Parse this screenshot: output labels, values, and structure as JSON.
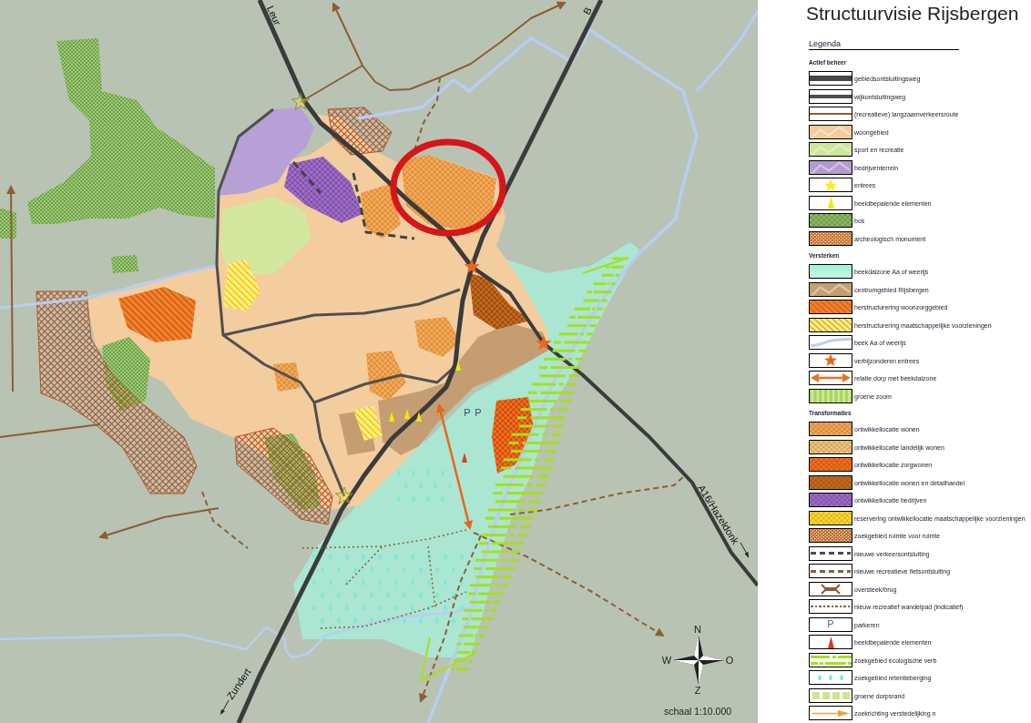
{
  "map": {
    "road_labels": [
      "Leur",
      "B",
      "A16/Hazeldonk",
      "Zundert"
    ],
    "parking_labels": [
      "P",
      "P"
    ],
    "compass": {
      "north": "N",
      "west": "W",
      "east": "O",
      "south": "Z"
    },
    "scale": "schaal 1:10.000"
  },
  "legend_panel": {
    "title": "Structuurvisie Rijsbergen",
    "heading": "Legenda",
    "sections": [
      {
        "title": "Actief beheer",
        "items": [
          {
            "label": "gebiedsontsluitingsweg",
            "kind": "line-thick",
            "color": "#464646"
          },
          {
            "label": "wijkontsluitingweg",
            "kind": "line-medium",
            "color": "#4d4d4d"
          },
          {
            "label": "(recreatieve) langzaamverkeersroute",
            "kind": "line-thin",
            "color": "#8c5e34"
          },
          {
            "label": "woongebied",
            "kind": "area",
            "color": "#f3cc9e"
          },
          {
            "label": "sport en recreatie",
            "kind": "area",
            "color": "#cfe79a"
          },
          {
            "label": "bedrijventerrein",
            "kind": "area",
            "color": "#b39bd0"
          },
          {
            "label": "entrees",
            "kind": "star",
            "color": "#f4ee1e"
          },
          {
            "label": "beeldbepalende elementen",
            "kind": "cone",
            "color": "#f2ea00"
          },
          {
            "label": "bos",
            "kind": "checker",
            "color": "#8fbd62"
          },
          {
            "label": "archeologisch monument",
            "kind": "crosshatch",
            "color": "#c8702a"
          }
        ]
      },
      {
        "title": "Versterken",
        "items": [
          {
            "label": "beekdalzone Aa of weerijs",
            "kind": "gradient",
            "color": "#a9f1da"
          },
          {
            "label": "centrumgebied Rijsbergen",
            "kind": "area",
            "color": "#c4a071"
          },
          {
            "label": "herstructurering woonzorggebied",
            "kind": "hatch",
            "color": "#f57e2a"
          },
          {
            "label": "herstructurering maatschappelijke voorzieningen",
            "kind": "hatch",
            "color": "#fff07a"
          },
          {
            "label": "beek Aa of weerijs",
            "kind": "stream",
            "color": "#b9d0f5"
          },
          {
            "label": "verbijzonderen entrees",
            "kind": "star",
            "color": "#e8661e"
          },
          {
            "label": "relatie dorp met beekdalzone",
            "kind": "double-arrow",
            "color": "#e8751e"
          },
          {
            "label": "groene zoom",
            "kind": "stripes",
            "color": "#a8d65a"
          }
        ]
      },
      {
        "title": "Transformaties",
        "items": [
          {
            "label": "ontwikkellocatie wonen",
            "kind": "lattice",
            "color": "#f2a653"
          },
          {
            "label": "ontwikkellocatie landelijk wonen",
            "kind": "lattice",
            "color": "#f0c27a"
          },
          {
            "label": "ontwikkellocatie zorgwonen",
            "kind": "lattice",
            "color": "#f26b1d"
          },
          {
            "label": "ontwikkellocatie wonen en detailhandel",
            "kind": "lattice",
            "color": "#c1681d"
          },
          {
            "label": "ontwikkellocatie bedrijven",
            "kind": "lattice",
            "color": "#9e66c6"
          },
          {
            "label": "reservering ontwikkellocatie maatschappelijke voorzieningen",
            "kind": "lattice",
            "color": "#ffd52a"
          },
          {
            "label": "zoekgebied ruimte voor ruimte",
            "kind": "crosshatch",
            "color": "#c06a2a"
          },
          {
            "label": "nieuwe verkeersontsluiting",
            "kind": "dashed",
            "color": "#4d4d4d"
          },
          {
            "label": "nieuwe recreatieve fietsontsluiting",
            "kind": "dashed",
            "color": "#8c5e34"
          },
          {
            "label": "oversteek/brug",
            "kind": "bridge",
            "color": "#8c5e34"
          },
          {
            "label": "nieuw recreatief wandelpad (indicatief)",
            "kind": "dotted",
            "color": "#8c5e34"
          },
          {
            "label": "parkeren",
            "kind": "letter",
            "symbol": "P"
          },
          {
            "label": "beeldbepalende elementen",
            "kind": "cone",
            "color": "#d8401a"
          },
          {
            "label": "zoekgebied ecologische verb",
            "kind": "eco-dashes",
            "color": "#a6e01a"
          },
          {
            "label": "zoekgebied retentieberging",
            "kind": "drops",
            "color": "#7fe8d8"
          },
          {
            "label": "groene dorpsrand",
            "kind": "squares",
            "color": "#cde68a"
          },
          {
            "label": "zoekrichting verstedelijking n",
            "kind": "arrow",
            "color": "#f0a040"
          }
        ]
      }
    ]
  }
}
